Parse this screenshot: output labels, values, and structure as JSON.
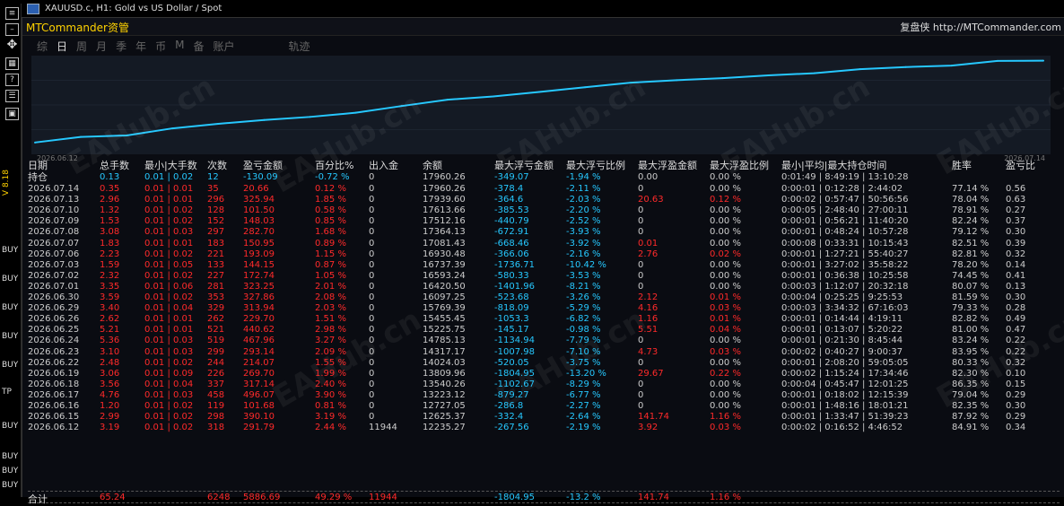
{
  "window": {
    "title": "XAUUSD.c, H1:  Gold vs US Dollar / Spot"
  },
  "app": {
    "brand": "MTCommander资管",
    "brand_right": "复盘侠 http://MTCommander.com"
  },
  "tabs": [
    {
      "label": "综",
      "active": false
    },
    {
      "label": "日",
      "active": true
    },
    {
      "label": "周",
      "active": false
    },
    {
      "label": "月",
      "active": false
    },
    {
      "label": "季",
      "active": false
    },
    {
      "label": "年",
      "active": false
    },
    {
      "label": "币",
      "active": false
    },
    {
      "label": "M",
      "active": false
    },
    {
      "label": "备",
      "active": false
    },
    {
      "label": "账户",
      "active": false
    },
    {
      "label": "轨迹",
      "active": false
    }
  ],
  "sidebar": {
    "version": "V 8.18",
    "labels": [
      "BUY",
      "BUY",
      "BUY",
      "BUY",
      "BUY",
      "TP",
      "BUY",
      "BUY",
      "BUY",
      "BUY"
    ]
  },
  "chart": {
    "start_date": "2026.06.12",
    "end_date": "2026.07.14",
    "watermark": "EAHub.cn",
    "accent": "#26c8ff"
  },
  "chart_data": {
    "type": "line",
    "x": [
      "2026.06.12",
      "2026.06.15",
      "2026.06.16",
      "2026.06.17",
      "2026.06.18",
      "2026.06.19",
      "2026.06.22",
      "2026.06.23",
      "2026.06.24",
      "2026.06.25",
      "2026.06.26",
      "2026.06.29",
      "2026.06.30",
      "2026.07.01",
      "2026.07.02",
      "2026.07.03",
      "2026.07.06",
      "2026.07.07",
      "2026.07.08",
      "2026.07.09",
      "2026.07.10",
      "2026.07.13",
      "2026.07.14"
    ],
    "series": [
      {
        "values": [
          12235.27,
          12625.37,
          12727.05,
          13223.12,
          13540.26,
          13809.96,
          14024.03,
          14317.17,
          14785.13,
          15225.75,
          15455.45,
          15769.39,
          16097.25,
          16420.5,
          16593.24,
          16737.39,
          16930.48,
          17081.43,
          17364.13,
          17512.16,
          17613.66,
          17939.6,
          17960.26
        ]
      }
    ]
  },
  "table": {
    "headers": [
      "日期",
      "总手数",
      "最小|大手数",
      "次数",
      "盈亏金额",
      "百分比%",
      "出入金",
      "余额",
      "最大浮亏金额",
      "最大浮亏比例",
      "最大浮盈金额",
      "最大浮盈比例",
      "最小|平均|最大持仓时间",
      "胜率",
      "盈亏比"
    ],
    "hold": {
      "label": "持仓",
      "lots": "0.13",
      "minmax": "0.01 | 0.02",
      "count": "12",
      "pnl": "-130.09",
      "pct": "-0.72 %",
      "io": "0",
      "bal": "17960.26",
      "maxloss": "-349.07",
      "lossratio": "-1.94 %",
      "maxgain": "0.00",
      "gainratio": "0.00 %",
      "time": "0:01:49 | 8:49:19 | 13:10:28"
    },
    "rows": [
      {
        "d": "2026.07.14",
        "l": "0.35",
        "mm": "0.01 | 0.01",
        "n": "35",
        "p": "20.66",
        "pc": "0.12 %",
        "io": "0",
        "b": "17960.26",
        "ml": "-378.4",
        "lr": "-2.11 %",
        "mg": "0",
        "gr": "0.00 %",
        "t": "0:00:01 | 0:12:28 | 2:44:02",
        "w": "77.14 %",
        "r": "0.56"
      },
      {
        "d": "2026.07.13",
        "l": "2.96",
        "mm": "0.01 | 0.01",
        "n": "296",
        "p": "325.94",
        "pc": "1.85 %",
        "io": "0",
        "b": "17939.60",
        "ml": "-364.6",
        "lr": "-2.03 %",
        "mg": "20.63",
        "gr": "0.12 %",
        "t": "0:00:02 | 0:57:47 | 50:56:56",
        "w": "78.04 %",
        "r": "0.63"
      },
      {
        "d": "2026.07.10",
        "l": "1.32",
        "mm": "0.01 | 0.02",
        "n": "128",
        "p": "101.50",
        "pc": "0.58 %",
        "io": "0",
        "b": "17613.66",
        "ml": "-385.53",
        "lr": "-2.20 %",
        "mg": "0",
        "gr": "0.00 %",
        "t": "0:00:05 | 2:48:40 | 27:00:11",
        "w": "78.91 %",
        "r": "0.27"
      },
      {
        "d": "2026.07.09",
        "l": "1.53",
        "mm": "0.01 | 0.02",
        "n": "152",
        "p": "148.03",
        "pc": "0.85 %",
        "io": "0",
        "b": "17512.16",
        "ml": "-440.79",
        "lr": "-2.52 %",
        "mg": "0",
        "gr": "0.00 %",
        "t": "0:00:01 | 0:56:21 | 11:40:20",
        "w": "82.24 %",
        "r": "0.37"
      },
      {
        "d": "2026.07.08",
        "l": "3.08",
        "mm": "0.01 | 0.03",
        "n": "297",
        "p": "282.70",
        "pc": "1.68 %",
        "io": "0",
        "b": "17364.13",
        "ml": "-672.91",
        "lr": "-3.93 %",
        "mg": "0",
        "gr": "0.00 %",
        "t": "0:00:01 | 0:48:24 | 10:57:28",
        "w": "79.12 %",
        "r": "0.30"
      },
      {
        "d": "2026.07.07",
        "l": "1.83",
        "mm": "0.01 | 0.01",
        "n": "183",
        "p": "150.95",
        "pc": "0.89 %",
        "io": "0",
        "b": "17081.43",
        "ml": "-668.46",
        "lr": "-3.92 %",
        "mg": "0.01",
        "gr": "0.00 %",
        "t": "0:00:08 | 0:33:31 | 10:15:43",
        "w": "82.51 %",
        "r": "0.39"
      },
      {
        "d": "2026.07.06",
        "l": "2.23",
        "mm": "0.01 | 0.02",
        "n": "221",
        "p": "193.09",
        "pc": "1.15 %",
        "io": "0",
        "b": "16930.48",
        "ml": "-366.06",
        "lr": "-2.16 %",
        "mg": "2.76",
        "gr": "0.02 %",
        "t": "0:00:01 | 1:27:21 | 55:40:27",
        "w": "82.81 %",
        "r": "0.32"
      },
      {
        "d": "2026.07.03",
        "l": "1.59",
        "mm": "0.01 | 0.05",
        "n": "133",
        "p": "144.15",
        "pc": "0.87 %",
        "io": "0",
        "b": "16737.39",
        "ml": "-1736.71",
        "lr": "-10.42 %",
        "mg": "0",
        "gr": "0.00 %",
        "t": "0:00:01 | 3:27:02 | 35:58:22",
        "w": "78.20 %",
        "r": "0.14"
      },
      {
        "d": "2026.07.02",
        "l": "2.32",
        "mm": "0.01 | 0.02",
        "n": "227",
        "p": "172.74",
        "pc": "1.05 %",
        "io": "0",
        "b": "16593.24",
        "ml": "-580.33",
        "lr": "-3.53 %",
        "mg": "0",
        "gr": "0.00 %",
        "t": "0:00:01 | 0:36:38 | 10:25:58",
        "w": "74.45 %",
        "r": "0.41"
      },
      {
        "d": "2026.07.01",
        "l": "3.35",
        "mm": "0.01 | 0.06",
        "n": "281",
        "p": "323.25",
        "pc": "2.01 %",
        "io": "0",
        "b": "16420.50",
        "ml": "-1401.96",
        "lr": "-8.21 %",
        "mg": "0",
        "gr": "0.00 %",
        "t": "0:00:03 | 1:12:07 | 20:32:18",
        "w": "80.07 %",
        "r": "0.13"
      },
      {
        "d": "2026.06.30",
        "l": "3.59",
        "mm": "0.01 | 0.02",
        "n": "353",
        "p": "327.86",
        "pc": "2.08 %",
        "io": "0",
        "b": "16097.25",
        "ml": "-523.68",
        "lr": "-3.26 %",
        "mg": "2.12",
        "gr": "0.01 %",
        "t": "0:00:04 | 0:25:25 | 9:25:53",
        "w": "81.59 %",
        "r": "0.30"
      },
      {
        "d": "2026.06.29",
        "l": "3.40",
        "mm": "0.01 | 0.04",
        "n": "329",
        "p": "313.94",
        "pc": "2.03 %",
        "io": "0",
        "b": "15769.39",
        "ml": "-818.09",
        "lr": "-5.29 %",
        "mg": "4.16",
        "gr": "0.03 %",
        "t": "0:00:03 | 3:34:32 | 67:16:03",
        "w": "79.33 %",
        "r": "0.28"
      },
      {
        "d": "2026.06.26",
        "l": "2.62",
        "mm": "0.01 | 0.01",
        "n": "262",
        "p": "229.70",
        "pc": "1.51 %",
        "io": "0",
        "b": "15455.45",
        "ml": "-1053.3",
        "lr": "-6.82 %",
        "mg": "1.16",
        "gr": "0.01 %",
        "t": "0:00:01 | 0:14:44 | 4:19:11",
        "w": "82.82 %",
        "r": "0.49"
      },
      {
        "d": "2026.06.25",
        "l": "5.21",
        "mm": "0.01 | 0.01",
        "n": "521",
        "p": "440.62",
        "pc": "2.98 %",
        "io": "0",
        "b": "15225.75",
        "ml": "-145.17",
        "lr": "-0.98 %",
        "mg": "5.51",
        "gr": "0.04 %",
        "t": "0:00:01 | 0:13:07 | 5:20:22",
        "w": "81.00 %",
        "r": "0.47"
      },
      {
        "d": "2026.06.24",
        "l": "5.36",
        "mm": "0.01 | 0.03",
        "n": "519",
        "p": "467.96",
        "pc": "3.27 %",
        "io": "0",
        "b": "14785.13",
        "ml": "-1134.94",
        "lr": "-7.79 %",
        "mg": "0",
        "gr": "0.00 %",
        "t": "0:00:01 | 0:21:30 | 8:45:44",
        "w": "83.24 %",
        "r": "0.22"
      },
      {
        "d": "2026.06.23",
        "l": "3.10",
        "mm": "0.01 | 0.03",
        "n": "299",
        "p": "293.14",
        "pc": "2.09 %",
        "io": "0",
        "b": "14317.17",
        "ml": "-1007.98",
        "lr": "-7.10 %",
        "mg": "4.73",
        "gr": "0.03 %",
        "t": "0:00:02 | 0:40:27 | 9:00:37",
        "w": "83.95 %",
        "r": "0.22"
      },
      {
        "d": "2026.06.22",
        "l": "2.48",
        "mm": "0.01 | 0.02",
        "n": "244",
        "p": "214.07",
        "pc": "1.55 %",
        "io": "0",
        "b": "14024.03",
        "ml": "-520.05",
        "lr": "-3.75 %",
        "mg": "0",
        "gr": "0.00 %",
        "t": "0:00:01 | 2:08:20 | 59:05:05",
        "w": "80.33 %",
        "r": "0.32"
      },
      {
        "d": "2026.06.19",
        "l": "3.06",
        "mm": "0.01 | 0.09",
        "n": "226",
        "p": "269.70",
        "pc": "1.99 %",
        "io": "0",
        "b": "13809.96",
        "ml": "-1804.95",
        "lr": "-13.20 %",
        "mg": "29.67",
        "gr": "0.22 %",
        "t": "0:00:02 | 1:15:24 | 17:34:46",
        "w": "82.30 %",
        "r": "0.10"
      },
      {
        "d": "2026.06.18",
        "l": "3.56",
        "mm": "0.01 | 0.04",
        "n": "337",
        "p": "317.14",
        "pc": "2.40 %",
        "io": "0",
        "b": "13540.26",
        "ml": "-1102.67",
        "lr": "-8.29 %",
        "mg": "0",
        "gr": "0.00 %",
        "t": "0:00:04 | 0:45:47 | 12:01:25",
        "w": "86.35 %",
        "r": "0.15"
      },
      {
        "d": "2026.06.17",
        "l": "4.76",
        "mm": "0.01 | 0.03",
        "n": "458",
        "p": "496.07",
        "pc": "3.90 %",
        "io": "0",
        "b": "13223.12",
        "ml": "-879.27",
        "lr": "-6.77 %",
        "mg": "0",
        "gr": "0.00 %",
        "t": "0:00:01 | 0:18:02 | 12:15:39",
        "w": "79.04 %",
        "r": "0.29"
      },
      {
        "d": "2026.06.16",
        "l": "1.20",
        "mm": "0.01 | 0.02",
        "n": "119",
        "p": "101.68",
        "pc": "0.81 %",
        "io": "0",
        "b": "12727.05",
        "ml": "-286.8",
        "lr": "-2.27 %",
        "mg": "0",
        "gr": "0.00 %",
        "t": "0:00:01 | 1:48:16 | 18:01:21",
        "w": "82.35 %",
        "r": "0.30"
      },
      {
        "d": "2026.06.15",
        "l": "2.99",
        "mm": "0.01 | 0.02",
        "n": "298",
        "p": "390.10",
        "pc": "3.19 %",
        "io": "0",
        "b": "12625.37",
        "ml": "-332.4",
        "lr": "-2.64 %",
        "mg": "141.74",
        "gr": "1.16 %",
        "t": "0:00:01 | 1:33:47 | 51:39:23",
        "w": "87.92 %",
        "r": "0.29"
      },
      {
        "d": "2026.06.12",
        "l": "3.19",
        "mm": "0.01 | 0.02",
        "n": "318",
        "p": "291.79",
        "pc": "2.44 %",
        "io": "11944",
        "b": "12235.27",
        "ml": "-267.56",
        "lr": "-2.19 %",
        "mg": "3.92",
        "gr": "0.03 %",
        "t": "0:00:02 | 0:16:52 | 4:46:52",
        "w": "84.91 %",
        "r": "0.34"
      }
    ],
    "total": {
      "label": "合计",
      "l": "65.24",
      "n": "6248",
      "p": "5886.69",
      "pc": "49.29 %",
      "io": "11944",
      "ml": "-1804.95",
      "lr": "-13.2 %",
      "mg": "141.74",
      "gr": "1.16 %"
    }
  }
}
